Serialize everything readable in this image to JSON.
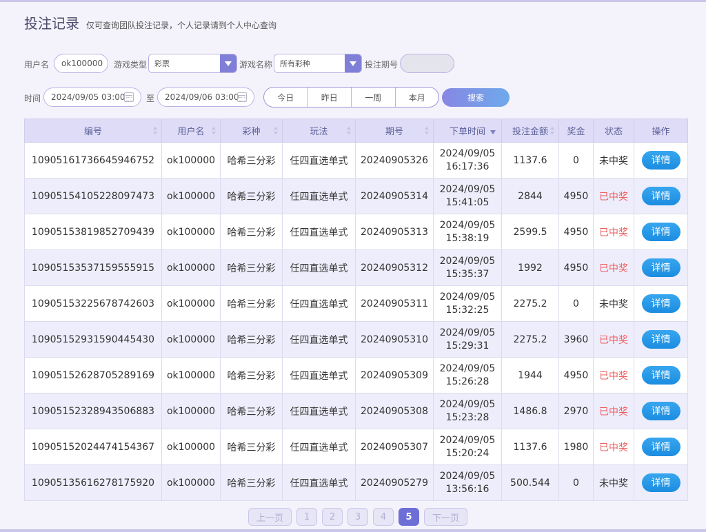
{
  "header": {
    "title": "投注记录",
    "subtitle": "仅可查询团队投注记录，个人记录请到个人中心查询"
  },
  "filters": {
    "username_label": "用户名",
    "username_value": "ok100000",
    "game_type_label": "游戏类型",
    "game_type_value": "彩票",
    "game_name_label": "游戏名称",
    "game_name_value": "所有彩种",
    "issue_label": "投注期号",
    "issue_value": "",
    "time_label": "时间",
    "start_time": "2024/09/05 03:00",
    "to_label": "至",
    "end_time": "2024/09/06 03:00",
    "quick_ranges": [
      "今日",
      "昨日",
      "一周",
      "本月"
    ],
    "search_label": "搜索"
  },
  "table": {
    "columns": [
      "编号",
      "用户名",
      "彩种",
      "玩法",
      "期号",
      "下单时间",
      "投注金额",
      "奖金",
      "状态",
      "操作"
    ],
    "rows": [
      {
        "id": "10905161736645946752",
        "user": "ok100000",
        "lottery": "哈希三分彩",
        "play": "任四直选单式",
        "issue": "20240905326",
        "date": "2024/09/05",
        "time": "16:17:36",
        "amount": "1137.6",
        "prize": "0",
        "status": "未中奖",
        "win": false,
        "action": "详情"
      },
      {
        "id": "10905154105228097473",
        "user": "ok100000",
        "lottery": "哈希三分彩",
        "play": "任四直选单式",
        "issue": "20240905314",
        "date": "2024/09/05",
        "time": "15:41:05",
        "amount": "2844",
        "prize": "4950",
        "status": "已中奖",
        "win": true,
        "action": "详情"
      },
      {
        "id": "10905153819852709439",
        "user": "ok100000",
        "lottery": "哈希三分彩",
        "play": "任四直选单式",
        "issue": "20240905313",
        "date": "2024/09/05",
        "time": "15:38:19",
        "amount": "2599.5",
        "prize": "4950",
        "status": "已中奖",
        "win": true,
        "action": "详情"
      },
      {
        "id": "10905153537159555915",
        "user": "ok100000",
        "lottery": "哈希三分彩",
        "play": "任四直选单式",
        "issue": "20240905312",
        "date": "2024/09/05",
        "time": "15:35:37",
        "amount": "1992",
        "prize": "4950",
        "status": "已中奖",
        "win": true,
        "action": "详情"
      },
      {
        "id": "10905153225678742603",
        "user": "ok100000",
        "lottery": "哈希三分彩",
        "play": "任四直选单式",
        "issue": "20240905311",
        "date": "2024/09/05",
        "time": "15:32:25",
        "amount": "2275.2",
        "prize": "0",
        "status": "未中奖",
        "win": false,
        "action": "详情"
      },
      {
        "id": "10905152931590445430",
        "user": "ok100000",
        "lottery": "哈希三分彩",
        "play": "任四直选单式",
        "issue": "20240905310",
        "date": "2024/09/05",
        "time": "15:29:31",
        "amount": "2275.2",
        "prize": "3960",
        "status": "已中奖",
        "win": true,
        "action": "详情"
      },
      {
        "id": "10905152628705289169",
        "user": "ok100000",
        "lottery": "哈希三分彩",
        "play": "任四直选单式",
        "issue": "20240905309",
        "date": "2024/09/05",
        "time": "15:26:28",
        "amount": "1944",
        "prize": "4950",
        "status": "已中奖",
        "win": true,
        "action": "详情"
      },
      {
        "id": "10905152328943506883",
        "user": "ok100000",
        "lottery": "哈希三分彩",
        "play": "任四直选单式",
        "issue": "20240905308",
        "date": "2024/09/05",
        "time": "15:23:28",
        "amount": "1486.8",
        "prize": "2970",
        "status": "已中奖",
        "win": true,
        "action": "详情"
      },
      {
        "id": "10905152024474154367",
        "user": "ok100000",
        "lottery": "哈希三分彩",
        "play": "任四直选单式",
        "issue": "20240905307",
        "date": "2024/09/05",
        "time": "15:20:24",
        "amount": "1137.6",
        "prize": "1980",
        "status": "已中奖",
        "win": true,
        "action": "详情"
      },
      {
        "id": "10905135616278175920",
        "user": "ok100000",
        "lottery": "哈希三分彩",
        "play": "任四直选单式",
        "issue": "20240905279",
        "date": "2024/09/05",
        "time": "13:56:16",
        "amount": "500.544",
        "prize": "0",
        "status": "未中奖",
        "win": false,
        "action": "详情"
      }
    ]
  },
  "pagination": {
    "prev_label": "上一页",
    "next_label": "下一页",
    "pages": [
      "1",
      "2",
      "3",
      "4",
      "5"
    ],
    "current": "5"
  },
  "colors": {
    "accent": "#6e6fd6",
    "win_status": "#ee5c5c",
    "detail_button": "#1b8de0",
    "header_bg": "#dedcf6"
  }
}
